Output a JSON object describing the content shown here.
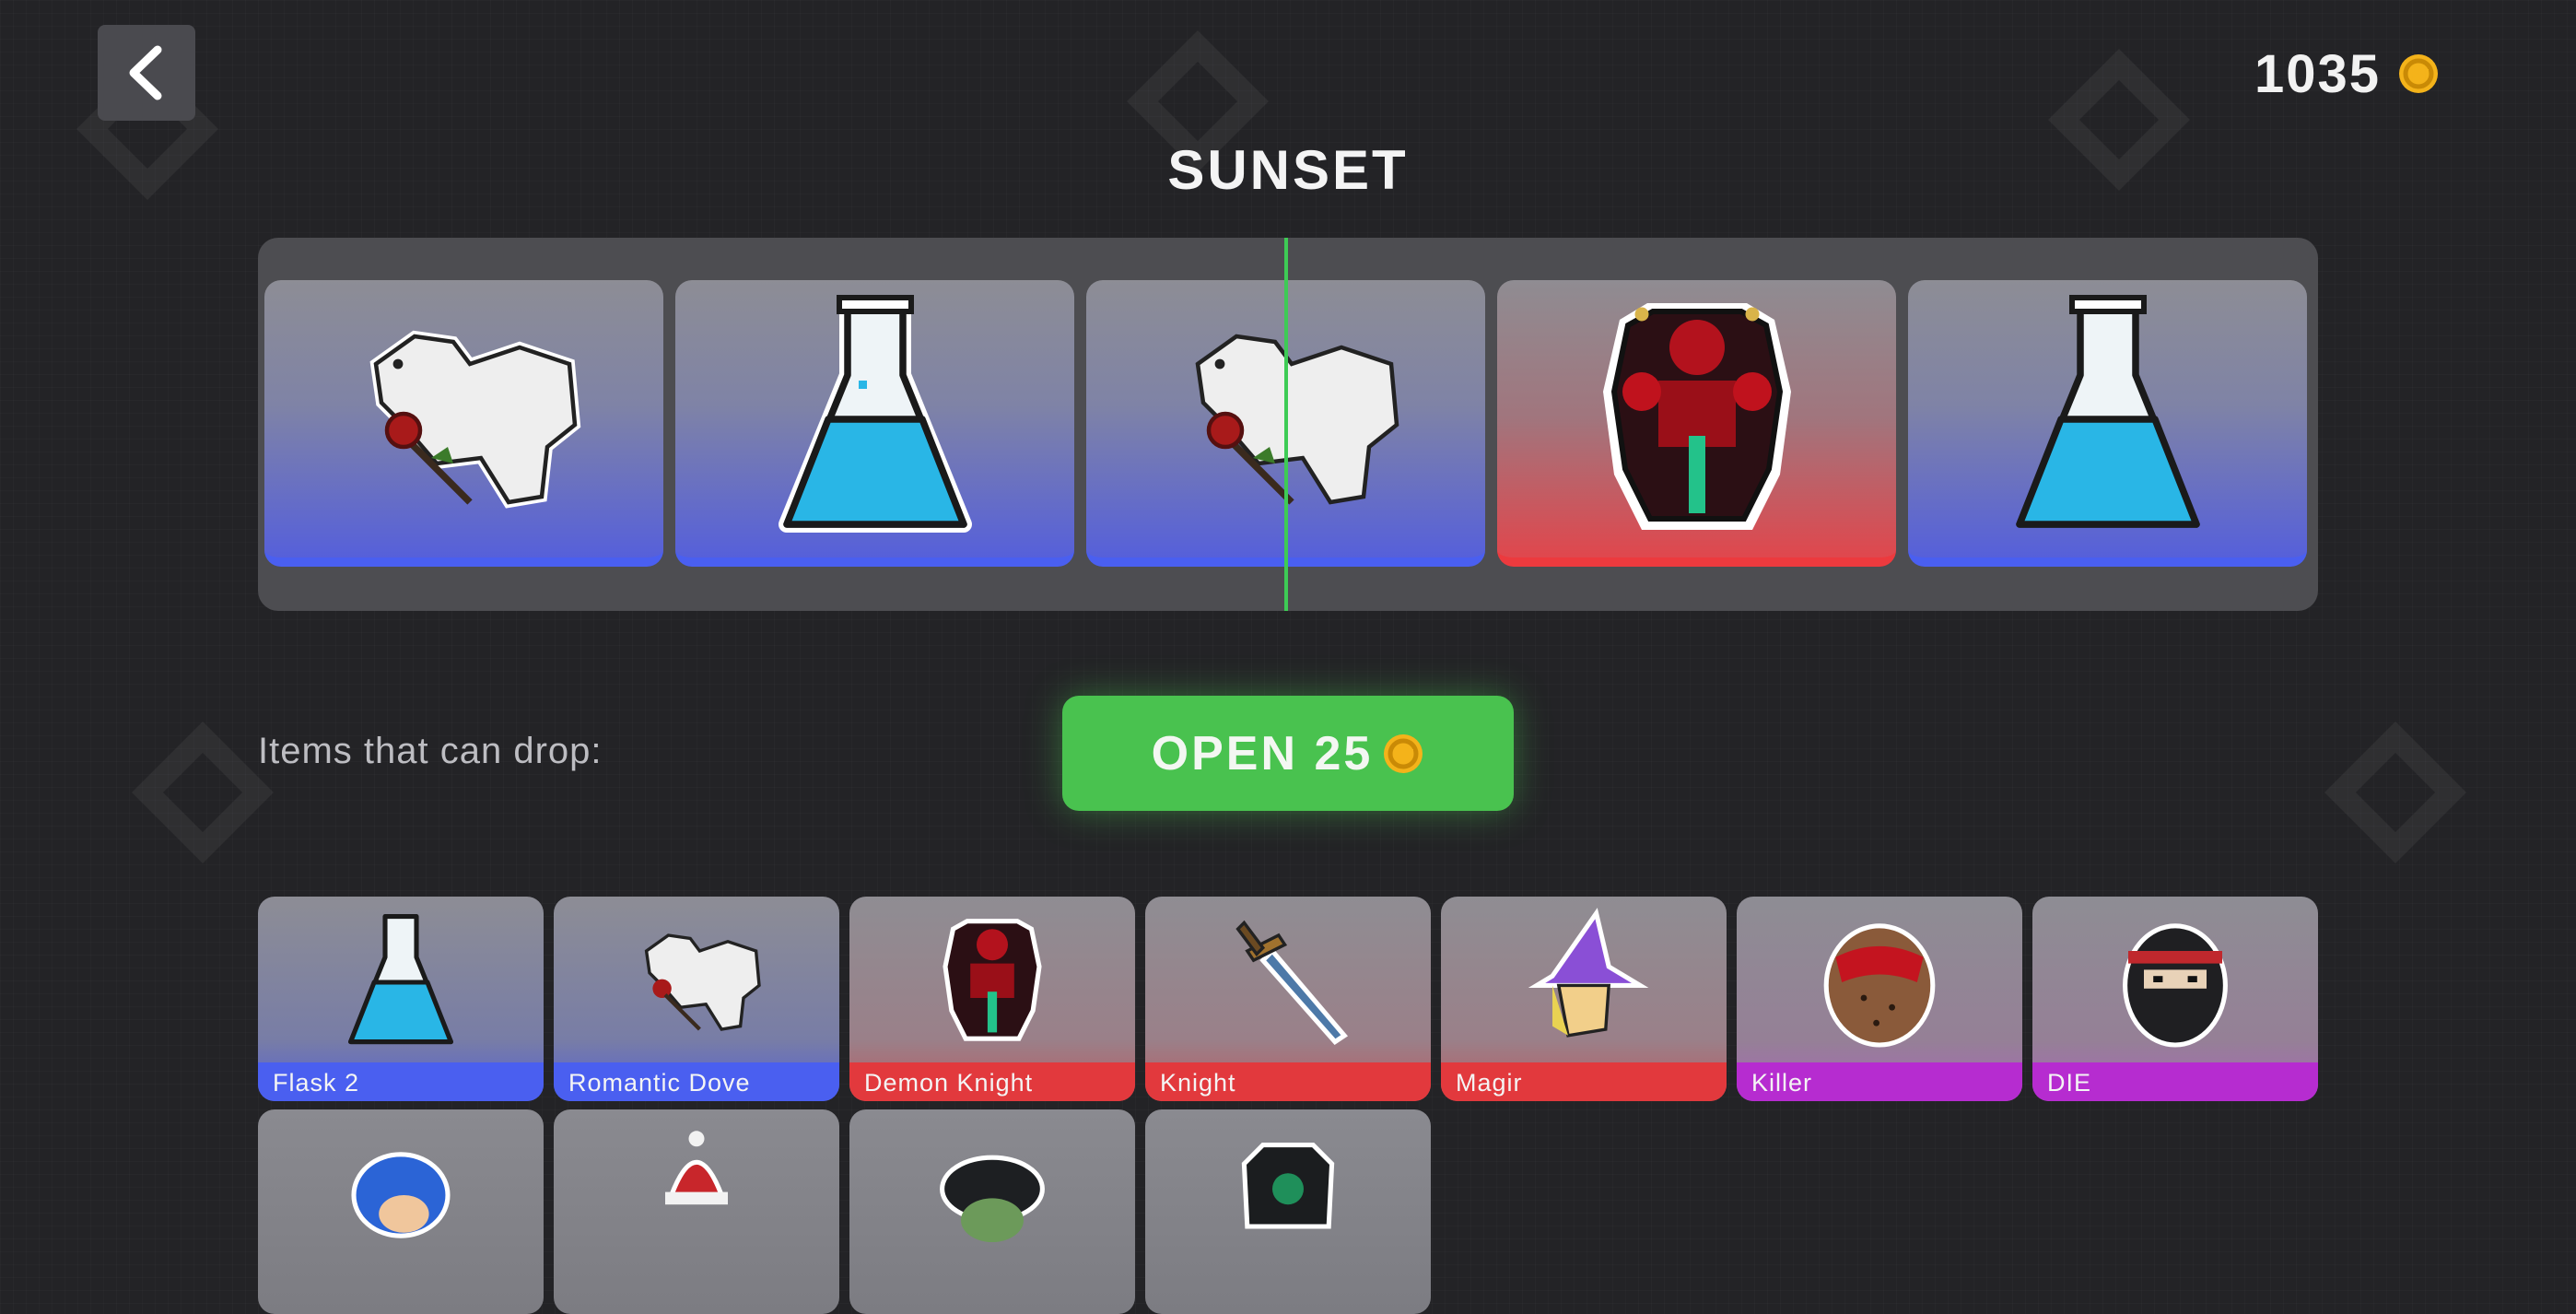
{
  "header": {
    "coins": "1035",
    "coin_icon": "gold-coin-icon",
    "back_icon": "chevron-left-icon"
  },
  "title": "SUNSET",
  "reel": {
    "cards": [
      {
        "item": "Romantic Dove",
        "icon": "dove-with-rose-icon",
        "rarity": "blue"
      },
      {
        "item": "Flask 2",
        "icon": "blue-flask-icon",
        "rarity": "blue"
      },
      {
        "item": "Romantic Dove",
        "icon": "dove-with-rose-icon",
        "rarity": "blue"
      },
      {
        "item": "Demon Knight",
        "icon": "demon-knight-armor-icon",
        "rarity": "red"
      },
      {
        "item": "Flask 2",
        "icon": "blue-flask-icon",
        "rarity": "blue"
      }
    ]
  },
  "drops_label": "Items that can drop:",
  "open_button": {
    "label": "OPEN 25",
    "icon": "gold-coin-icon"
  },
  "items": [
    {
      "name": "Flask 2",
      "rarity": "blue",
      "icon": "blue-flask-icon"
    },
    {
      "name": "Romantic Dove",
      "rarity": "blue",
      "icon": "dove-with-rose-icon"
    },
    {
      "name": "Demon Knight",
      "rarity": "red",
      "icon": "demon-knight-armor-icon"
    },
    {
      "name": "Knight",
      "rarity": "red",
      "icon": "sword-icon"
    },
    {
      "name": "Magir",
      "rarity": "red",
      "icon": "wizard-hat-icon"
    },
    {
      "name": "Killer",
      "rarity": "purple",
      "icon": "bloody-mask-icon"
    },
    {
      "name": "DIE",
      "rarity": "purple",
      "icon": "ninja-mask-icon"
    },
    {
      "name": "",
      "rarity": "grey",
      "icon": "blue-hair-head-icon"
    },
    {
      "name": "",
      "rarity": "grey",
      "icon": "santa-hat-icon"
    },
    {
      "name": "",
      "rarity": "grey",
      "icon": "dark-hair-head-icon"
    },
    {
      "name": "",
      "rarity": "grey",
      "icon": "green-eyed-helmet-icon"
    }
  ],
  "colors": {
    "background": "#232326",
    "accent_green": "#49c24f",
    "coin_gold": "#f4b31a",
    "rarity_blue": "#4a5ff0",
    "rarity_red": "#e2393d",
    "rarity_purple": "#b62cd0"
  }
}
